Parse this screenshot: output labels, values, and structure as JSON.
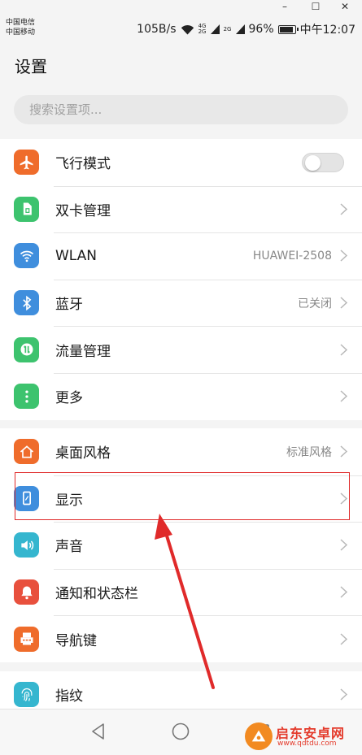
{
  "window": {
    "minimize": "–",
    "maximize": "☐",
    "close": "✕"
  },
  "status": {
    "carrier1": "中国电信",
    "carrier2": "中国移动",
    "speed": "105B/s",
    "net1": "4G",
    "net1b": "2G",
    "net2": "2G",
    "battery": "96%",
    "time": "中午12:07"
  },
  "header": {
    "title": "设置"
  },
  "search": {
    "placeholder": "搜索设置项..."
  },
  "groups": [
    {
      "items": [
        {
          "label": "飞行模式",
          "icon": "airplane-icon",
          "color": "#ef6c2b",
          "control": "toggle",
          "toggle_on": false
        },
        {
          "label": "双卡管理",
          "icon": "sim-card-icon",
          "color": "#3dc36e",
          "control": "chevron"
        },
        {
          "label": "WLAN",
          "icon": "wifi-icon",
          "color": "#3f8edd",
          "value": "HUAWEI-2508",
          "control": "chevron"
        },
        {
          "label": "蓝牙",
          "icon": "bluetooth-icon",
          "color": "#3f8edd",
          "value": "已关闭",
          "control": "chevron"
        },
        {
          "label": "流量管理",
          "icon": "data-usage-icon",
          "color": "#3dc36e",
          "control": "chevron"
        },
        {
          "label": "更多",
          "icon": "more-icon",
          "color": "#3dc36e",
          "control": "chevron"
        }
      ]
    },
    {
      "items": [
        {
          "label": "桌面风格",
          "icon": "home-icon",
          "color": "#ef6c2b",
          "value": "标准风格",
          "control": "chevron"
        },
        {
          "label": "显示",
          "icon": "display-icon",
          "color": "#3f8edd",
          "control": "chevron"
        },
        {
          "label": "声音",
          "icon": "sound-icon",
          "color": "#35b6cf",
          "control": "chevron"
        },
        {
          "label": "通知和状态栏",
          "icon": "notification-icon",
          "color": "#e8503d",
          "control": "chevron"
        },
        {
          "label": "导航键",
          "icon": "navigation-key-icon",
          "color": "#ef6c2b",
          "control": "chevron"
        }
      ]
    },
    {
      "items": [
        {
          "label": "指纹",
          "icon": "fingerprint-icon",
          "color": "#35b6cf",
          "control": "chevron"
        }
      ]
    }
  ],
  "watermark": {
    "title": "启东安卓网",
    "url": "www.qdtdu.com"
  }
}
